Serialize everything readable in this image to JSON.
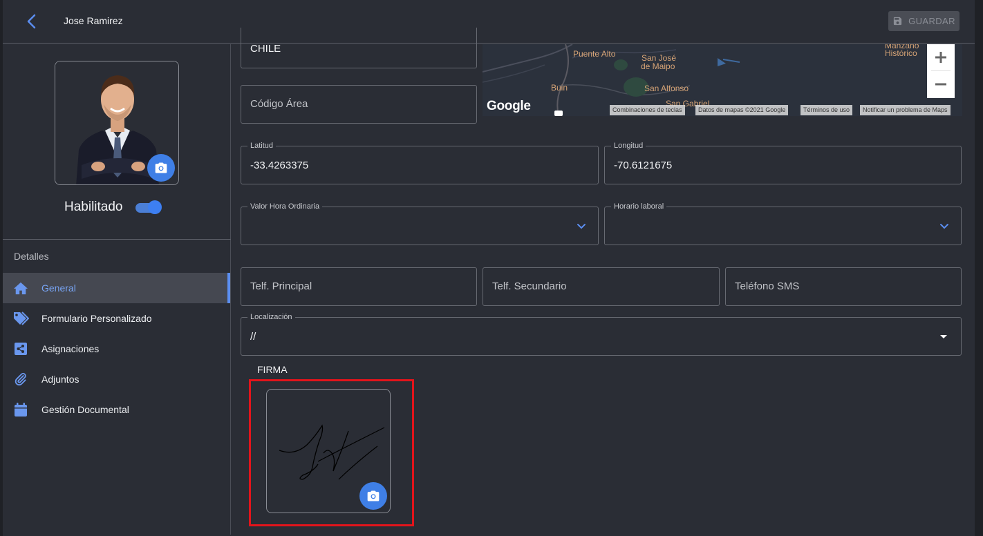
{
  "header": {
    "title": "Jose Ramirez",
    "save_label": "GUARDAR"
  },
  "profile": {
    "enabled_label": "Habilitado",
    "enabled": true
  },
  "sidebar": {
    "section_label": "Detalles",
    "items": [
      {
        "label": "General",
        "icon": "home-icon",
        "active": true
      },
      {
        "label": "Formulario Personalizado",
        "icon": "tag-icon",
        "active": false
      },
      {
        "label": "Asignaciones",
        "icon": "share-icon",
        "active": false
      },
      {
        "label": "Adjuntos",
        "icon": "paperclip-icon",
        "active": false
      },
      {
        "label": "Gestión Documental",
        "icon": "calendar-icon",
        "active": false
      }
    ]
  },
  "form": {
    "country_value": "CHILE",
    "area_code_placeholder": "Código Área",
    "latitude": {
      "label": "Latitud",
      "value": "-33.4263375"
    },
    "longitude": {
      "label": "Longitud",
      "value": "-70.6121675"
    },
    "hourly_rate": {
      "label": "Valor Hora Ordinaria",
      "value": ""
    },
    "work_schedule": {
      "label": "Horario laboral",
      "value": ""
    },
    "phone_main_placeholder": "Telf. Principal",
    "phone_secondary_placeholder": "Telf. Secundario",
    "phone_sms_placeholder": "Teléfono SMS",
    "location": {
      "label": "Localización",
      "value": "//"
    },
    "signature_label": "FIRMA"
  },
  "map": {
    "labels": [
      "Puente Alto",
      "San José",
      "de Maipo",
      "Buin",
      "San Alfonso",
      "San Gabriel",
      "Manzano",
      "Histórico"
    ],
    "google_logo": "Google",
    "attributions": [
      "Combinaciones de teclas",
      "Datos de mapas ©2021 Google",
      "Términos de uso",
      "Notificar un problema de Maps"
    ],
    "zoom_in": "+",
    "zoom_out": "−"
  },
  "colors": {
    "accent": "#3f7fe6",
    "background": "#2a2d35",
    "highlight": "#e3141b"
  }
}
